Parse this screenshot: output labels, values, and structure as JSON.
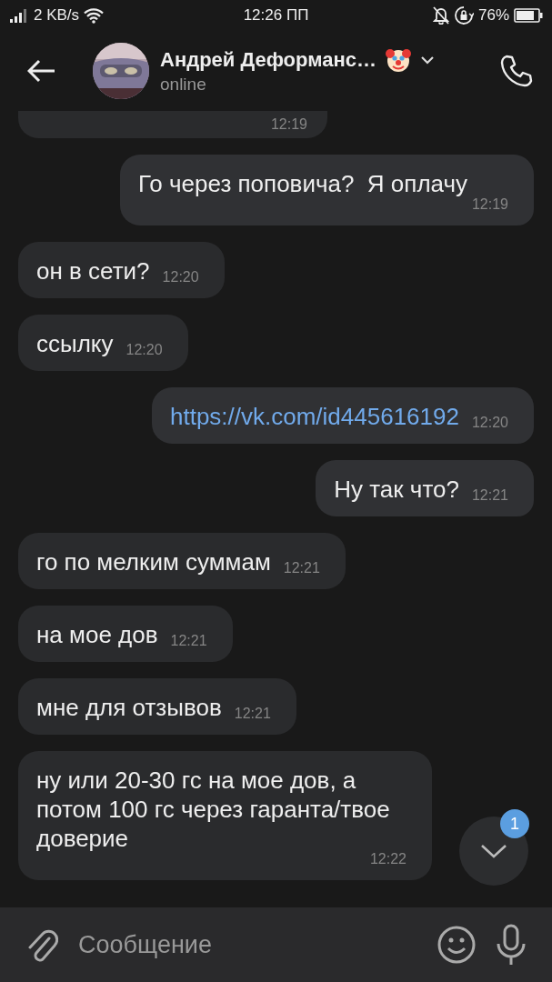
{
  "status_bar": {
    "network_speed": "2 KB/s",
    "time": "12:26 ПП",
    "battery": "76%"
  },
  "header": {
    "name": "Андрей Деформанс…",
    "status": "online"
  },
  "messages": [
    {
      "outgoing": false,
      "kind": "cut",
      "time": "12:19"
    },
    {
      "outgoing": true,
      "kind": "text",
      "text": "Го через поповича?  Я оплачу",
      "time": "12:19"
    },
    {
      "outgoing": false,
      "kind": "text",
      "text": "он в сети?",
      "time": "12:20"
    },
    {
      "outgoing": false,
      "kind": "text",
      "text": "ссылку",
      "time": "12:20"
    },
    {
      "outgoing": true,
      "kind": "link",
      "text": "https://vk.com/id445616192",
      "time": "12:20"
    },
    {
      "outgoing": true,
      "kind": "text",
      "text": "Ну так что?",
      "time": "12:21"
    },
    {
      "outgoing": false,
      "kind": "text",
      "text": "го по мелким суммам",
      "time": "12:21"
    },
    {
      "outgoing": false,
      "kind": "text",
      "text": "на мое дов",
      "time": "12:21"
    },
    {
      "outgoing": false,
      "kind": "text",
      "text": "мне для отзывов",
      "time": "12:21"
    },
    {
      "outgoing": false,
      "kind": "text",
      "text": "ну или 20-30 гс на мое дов, а потом 100 гс через гаранта/твое доверие",
      "time": "12:22"
    }
  ],
  "scroll_down": {
    "badge": "1"
  },
  "composer": {
    "placeholder": "Сообщение"
  }
}
